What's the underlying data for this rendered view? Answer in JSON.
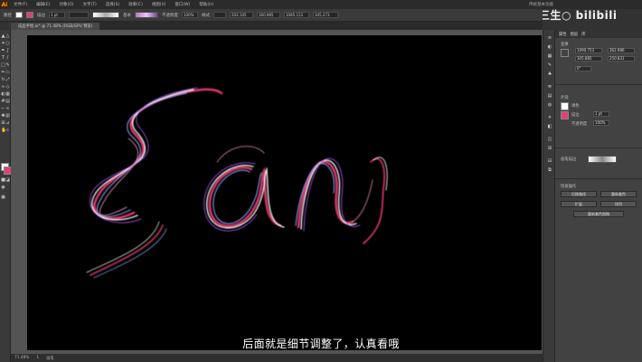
{
  "app": {
    "logo": "Ai",
    "window_title": "传统基本功能",
    "watermark": "○三生○  bilibili"
  },
  "menu": [
    "文件(F)",
    "编辑(E)",
    "对象(O)",
    "文字(T)",
    "选择(S)",
    "效果(C)",
    "视图(V)",
    "窗口(W)",
    "帮助(H)"
  ],
  "controlbar": {
    "path_label": "路径",
    "stroke_label": "描边",
    "stroke_weight": "1 pt",
    "brush_label": "基本",
    "opacity_label": "不透明度",
    "opacity_value": "100%",
    "style_label": "样式",
    "x_value": "202.105",
    "y_value": "160.985",
    "w_value": "1085.153",
    "h_value": "345.273"
  },
  "document": {
    "tab_title": "成品手绘.ai* @ 71.48% (RGB/GPU 预览)"
  },
  "status": {
    "zoom": "71.48%",
    "page": "1",
    "tool": "画笔"
  },
  "subtitle": "后面就是细节调整了，认真看哦",
  "artwork": {
    "text": "San",
    "colors": [
      "#ff2f6e",
      "#ff8fb2",
      "#ffffff",
      "#7aa7ff",
      "#b15bff"
    ]
  },
  "panel": {
    "tabs": [
      "属性",
      "图层",
      "库"
    ],
    "transform_label": "变换",
    "x": "1090.753",
    "y": "305.885",
    "w": "362.986",
    "h": "250.831",
    "angle": "0°",
    "appearance_label": "外观",
    "fill_label": "填色",
    "stroke_label": "描边",
    "stroke_value": "1 pt",
    "opacity_label": "不透明度",
    "opacity_value": "100%",
    "brush_label": "画笔描边",
    "quick_actions_label": "快速操作",
    "btn_offset": "位移路径",
    "btn_recolor": "重新着色",
    "btn_expand": "扩展",
    "btn_arrange": "排列",
    "btn_recolor2": "重新着色图稿"
  }
}
